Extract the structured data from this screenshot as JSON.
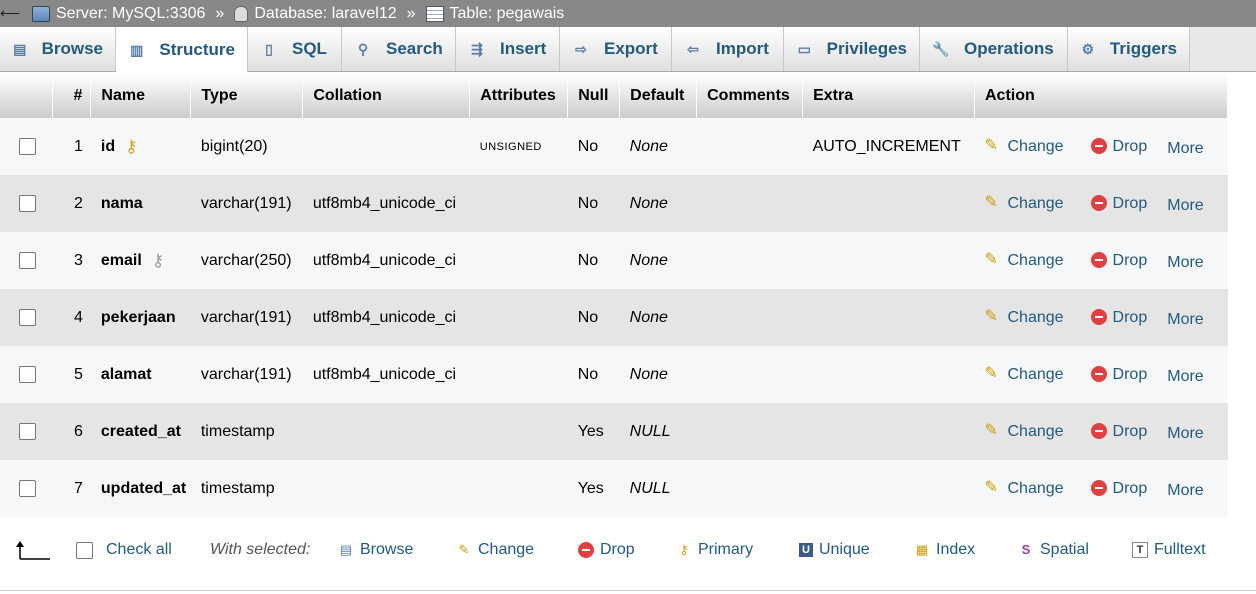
{
  "breadcrumb": {
    "server": "Server: MySQL:3306",
    "database": "Database: laravel12",
    "table": "Table: pegawais",
    "separator": "»"
  },
  "tabs": [
    {
      "label": "Browse",
      "icon": "browse-icon"
    },
    {
      "label": "Structure",
      "icon": "structure-icon",
      "active": true
    },
    {
      "label": "SQL",
      "icon": "sql-icon"
    },
    {
      "label": "Search",
      "icon": "search-icon"
    },
    {
      "label": "Insert",
      "icon": "insert-icon"
    },
    {
      "label": "Export",
      "icon": "export-icon"
    },
    {
      "label": "Import",
      "icon": "import-icon"
    },
    {
      "label": "Privileges",
      "icon": "privileges-icon"
    },
    {
      "label": "Operations",
      "icon": "wrench-icon"
    },
    {
      "label": "Triggers",
      "icon": "triggers-icon"
    }
  ],
  "columns": [
    "#",
    "Name",
    "Type",
    "Collation",
    "Attributes",
    "Null",
    "Default",
    "Comments",
    "Extra",
    "Action"
  ],
  "rows": [
    {
      "num": "1",
      "name": "id",
      "type": "bigint(20)",
      "collation": "",
      "attributes": "UNSIGNED",
      "null": "No",
      "default": "None",
      "comments": "",
      "extra": "AUTO_INCREMENT",
      "key": "primary"
    },
    {
      "num": "2",
      "name": "nama",
      "type": "varchar(191)",
      "collation": "utf8mb4_unicode_ci",
      "attributes": "",
      "null": "No",
      "default": "None",
      "comments": "",
      "extra": "",
      "key": ""
    },
    {
      "num": "3",
      "name": "email",
      "type": "varchar(250)",
      "collation": "utf8mb4_unicode_ci",
      "attributes": "",
      "null": "No",
      "default": "None",
      "comments": "",
      "extra": "",
      "key": "unique"
    },
    {
      "num": "4",
      "name": "pekerjaan",
      "type": "varchar(191)",
      "collation": "utf8mb4_unicode_ci",
      "attributes": "",
      "null": "No",
      "default": "None",
      "comments": "",
      "extra": "",
      "key": ""
    },
    {
      "num": "5",
      "name": "alamat",
      "type": "varchar(191)",
      "collation": "utf8mb4_unicode_ci",
      "attributes": "",
      "null": "No",
      "default": "None",
      "comments": "",
      "extra": "",
      "key": ""
    },
    {
      "num": "6",
      "name": "created_at",
      "type": "timestamp",
      "collation": "",
      "attributes": "",
      "null": "Yes",
      "default": "NULL",
      "comments": "",
      "extra": "",
      "key": ""
    },
    {
      "num": "7",
      "name": "updated_at",
      "type": "timestamp",
      "collation": "",
      "attributes": "",
      "null": "Yes",
      "default": "NULL",
      "comments": "",
      "extra": "",
      "key": ""
    }
  ],
  "row_actions": {
    "change": "Change",
    "drop": "Drop",
    "more": "More"
  },
  "footer": {
    "check_all": "Check all",
    "with_selected": "With selected:",
    "actions": [
      {
        "label": "Browse",
        "icon": "browse-icon"
      },
      {
        "label": "Change",
        "icon": "pencil-icon"
      },
      {
        "label": "Drop",
        "icon": "drop-icon"
      },
      {
        "label": "Primary",
        "icon": "key-icon"
      },
      {
        "label": "Unique",
        "icon": "unique-icon"
      },
      {
        "label": "Index",
        "icon": "index-icon"
      },
      {
        "label": "Spatial",
        "icon": "spatial-icon"
      },
      {
        "label": "Fulltext",
        "icon": "fulltext-icon"
      }
    ]
  },
  "colors": {
    "link": "#235a81",
    "topbar": "#888888",
    "row_odd": "#f5f7f9",
    "row_even": "#e5e5e5"
  }
}
